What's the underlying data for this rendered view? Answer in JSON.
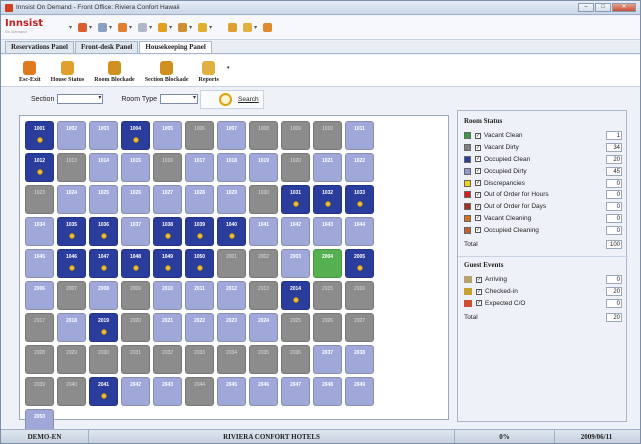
{
  "window": {
    "title": "Innsist On Demand - Front Office: Riviera Confort Hawaii",
    "min_label": "–",
    "max_label": "□",
    "close_label": "✕"
  },
  "logo": {
    "name": "Innsist",
    "tagline": "On Demand"
  },
  "tabs": [
    {
      "label": "Reservations Panel",
      "active": false
    },
    {
      "label": "Front-desk Panel",
      "active": false
    },
    {
      "label": "Housekeeping Panel",
      "active": true
    }
  ],
  "ribbon": [
    {
      "label": "Esc-Exit",
      "icon": "exit-icon",
      "color": "#e07a20"
    },
    {
      "label": "House Status",
      "icon": "house-status-icon",
      "color": "#e0a030"
    },
    {
      "label": "Room Blockade",
      "icon": "lock-icon",
      "color": "#d09020"
    },
    {
      "label": "Section Blockade",
      "icon": "lock-icon",
      "color": "#d09020"
    },
    {
      "label": "Reports",
      "icon": "reports-icon",
      "color": "#e0b040"
    }
  ],
  "filters": {
    "section_label": "Section",
    "section_value": "",
    "room_type_label": "Room Type",
    "room_type_value": "",
    "search_label": "Search"
  },
  "colors": {
    "vacant_clean": "#9fa8d8",
    "vacant_dirty": "#8c8c8c",
    "occupied_clean": "#2b3d9c",
    "occupied_dirty": "#8e98d4",
    "highlight": "#55b050"
  },
  "rooms": [
    {
      "n": "1001",
      "s": "oc",
      "k": true
    },
    {
      "n": "1002",
      "s": "vc"
    },
    {
      "n": "1003",
      "s": "vc"
    },
    {
      "n": "1004",
      "s": "oc",
      "k": true
    },
    {
      "n": "1005",
      "s": "vc"
    },
    {
      "n": "1006",
      "s": "vd"
    },
    {
      "n": "1007",
      "s": "vc"
    },
    {
      "n": "1008",
      "s": "vd"
    },
    {
      "n": "1009",
      "s": "vd"
    },
    {
      "n": "1010",
      "s": "vd"
    },
    {
      "n": "1011",
      "s": "vc"
    },
    {
      "n": "",
      "s": "none"
    },
    {
      "n": "",
      "s": "none"
    },
    {
      "n": "1012",
      "s": "oc",
      "k": true
    },
    {
      "n": "1013",
      "s": "vd"
    },
    {
      "n": "1014",
      "s": "vc"
    },
    {
      "n": "1015",
      "s": "vc"
    },
    {
      "n": "1016",
      "s": "vd"
    },
    {
      "n": "1017",
      "s": "vc"
    },
    {
      "n": "1018",
      "s": "vc"
    },
    {
      "n": "1019",
      "s": "vc"
    },
    {
      "n": "1020",
      "s": "vd"
    },
    {
      "n": "1021",
      "s": "vc"
    },
    {
      "n": "1022",
      "s": "vc"
    },
    {
      "n": "",
      "s": "none"
    },
    {
      "n": "",
      "s": "none"
    },
    {
      "n": "1023",
      "s": "vd"
    },
    {
      "n": "1024",
      "s": "vc"
    },
    {
      "n": "1025",
      "s": "vc"
    },
    {
      "n": "1026",
      "s": "vc"
    },
    {
      "n": "1027",
      "s": "vc"
    },
    {
      "n": "1028",
      "s": "vc"
    },
    {
      "n": "1029",
      "s": "vc"
    },
    {
      "n": "1030",
      "s": "vd"
    },
    {
      "n": "1031",
      "s": "oc",
      "k": true
    },
    {
      "n": "1032",
      "s": "oc",
      "k": true
    },
    {
      "n": "1033",
      "s": "oc",
      "k": true
    },
    {
      "n": "",
      "s": "none"
    },
    {
      "n": "",
      "s": "none"
    },
    {
      "n": "1034",
      "s": "vc"
    },
    {
      "n": "1035",
      "s": "oc",
      "k": true
    },
    {
      "n": "1036",
      "s": "oc",
      "k": true
    },
    {
      "n": "1037",
      "s": "vc"
    },
    {
      "n": "1038",
      "s": "oc",
      "k": true
    },
    {
      "n": "1039",
      "s": "oc",
      "k": true
    },
    {
      "n": "1040",
      "s": "oc",
      "k": true
    },
    {
      "n": "1041",
      "s": "vc"
    },
    {
      "n": "1042",
      "s": "vc"
    },
    {
      "n": "1043",
      "s": "vc"
    },
    {
      "n": "1044",
      "s": "vc"
    },
    {
      "n": "",
      "s": "none"
    },
    {
      "n": "",
      "s": "none"
    },
    {
      "n": "1045",
      "s": "vc"
    },
    {
      "n": "1046",
      "s": "oc",
      "k": true
    },
    {
      "n": "1047",
      "s": "oc",
      "k": true
    },
    {
      "n": "1048",
      "s": "oc",
      "k": true
    },
    {
      "n": "1049",
      "s": "oc",
      "k": true
    },
    {
      "n": "1050",
      "s": "oc",
      "k": true
    },
    {
      "n": "2001",
      "s": "vd"
    },
    {
      "n": "2002",
      "s": "vd"
    },
    {
      "n": "2003",
      "s": "vc"
    },
    {
      "n": "2004",
      "s": "grn"
    },
    {
      "n": "2005",
      "s": "oc",
      "k": true
    },
    {
      "n": "",
      "s": "none"
    },
    {
      "n": "",
      "s": "none"
    },
    {
      "n": "2006",
      "s": "vc"
    },
    {
      "n": "2007",
      "s": "vd"
    },
    {
      "n": "2008",
      "s": "vc"
    },
    {
      "n": "2009",
      "s": "vd"
    },
    {
      "n": "2010",
      "s": "vc"
    },
    {
      "n": "2011",
      "s": "vc"
    },
    {
      "n": "2012",
      "s": "vc"
    },
    {
      "n": "2013",
      "s": "vd"
    },
    {
      "n": "2014",
      "s": "oc",
      "k": true
    },
    {
      "n": "2015",
      "s": "vd"
    },
    {
      "n": "2016",
      "s": "vd"
    },
    {
      "n": "",
      "s": "none"
    },
    {
      "n": "",
      "s": "none"
    },
    {
      "n": "2017",
      "s": "vd"
    },
    {
      "n": "2018",
      "s": "vc"
    },
    {
      "n": "2019",
      "s": "oc",
      "k": true
    },
    {
      "n": "2020",
      "s": "vd"
    },
    {
      "n": "2021",
      "s": "vc"
    },
    {
      "n": "2022",
      "s": "vc"
    },
    {
      "n": "2023",
      "s": "vc"
    },
    {
      "n": "2024",
      "s": "vc"
    },
    {
      "n": "2025",
      "s": "vd"
    },
    {
      "n": "2026",
      "s": "vd"
    },
    {
      "n": "2027",
      "s": "vd"
    },
    {
      "n": "",
      "s": "none"
    },
    {
      "n": "",
      "s": "none"
    },
    {
      "n": "2028",
      "s": "vd"
    },
    {
      "n": "2029",
      "s": "vd"
    },
    {
      "n": "2030",
      "s": "vd"
    },
    {
      "n": "2031",
      "s": "vd"
    },
    {
      "n": "2032",
      "s": "vd"
    },
    {
      "n": "2033",
      "s": "vd"
    },
    {
      "n": "2034",
      "s": "vd"
    },
    {
      "n": "2035",
      "s": "vd"
    },
    {
      "n": "2036",
      "s": "vd"
    },
    {
      "n": "2037",
      "s": "vc"
    },
    {
      "n": "2038",
      "s": "vc"
    },
    {
      "n": "",
      "s": "none"
    },
    {
      "n": "",
      "s": "none"
    },
    {
      "n": "2039",
      "s": "vd"
    },
    {
      "n": "2040",
      "s": "vd"
    },
    {
      "n": "2041",
      "s": "oc",
      "k": true
    },
    {
      "n": "2042",
      "s": "vc"
    },
    {
      "n": "2043",
      "s": "vc"
    },
    {
      "n": "2044",
      "s": "vd"
    },
    {
      "n": "2045",
      "s": "vc"
    },
    {
      "n": "2046",
      "s": "vc"
    },
    {
      "n": "2047",
      "s": "vc"
    },
    {
      "n": "2048",
      "s": "vc"
    },
    {
      "n": "2049",
      "s": "vc"
    },
    {
      "n": "",
      "s": "none"
    },
    {
      "n": "",
      "s": "none"
    },
    {
      "n": "2050",
      "s": "vc"
    }
  ],
  "room_status": {
    "title": "Room Status",
    "items": [
      {
        "label": "Vacant Clean",
        "value": "1",
        "color": "#3a9a3a"
      },
      {
        "label": "Vacant Dirty",
        "value": "34",
        "color": "#808080"
      },
      {
        "label": "Occupied Clean",
        "value": "20",
        "color": "#2b3d9c"
      },
      {
        "label": "Occupied Dirty",
        "value": "45",
        "color": "#8e98d4"
      },
      {
        "label": "Discrepancies",
        "value": "0",
        "color": "#f0d020"
      },
      {
        "label": "Out of Order for Hours",
        "value": "0",
        "color": "#d82020"
      },
      {
        "label": "Out of Order for Days",
        "value": "0",
        "color": "#a83020"
      },
      {
        "label": "Vacant Cleaning",
        "value": "0",
        "color": "#d07020"
      },
      {
        "label": "Occupied Cleaning",
        "value": "0",
        "color": "#c06030"
      }
    ],
    "total_label": "Total",
    "total_value": "100"
  },
  "guest_events": {
    "title": "Guest Events",
    "items": [
      {
        "label": "Arriving",
        "value": "0",
        "icon": "arriving-icon"
      },
      {
        "label": "Checked-in",
        "value": "20",
        "icon": "key-icon"
      },
      {
        "label": "Expected C/O",
        "value": "0",
        "icon": "checkout-icon"
      }
    ],
    "total_label": "Total",
    "total_value": "20"
  },
  "statusbar": {
    "user": "DEMO-EN",
    "hotel": "RIVIERA CONFORT HOTELS",
    "progress": "0%",
    "date": "2009/06/11"
  }
}
